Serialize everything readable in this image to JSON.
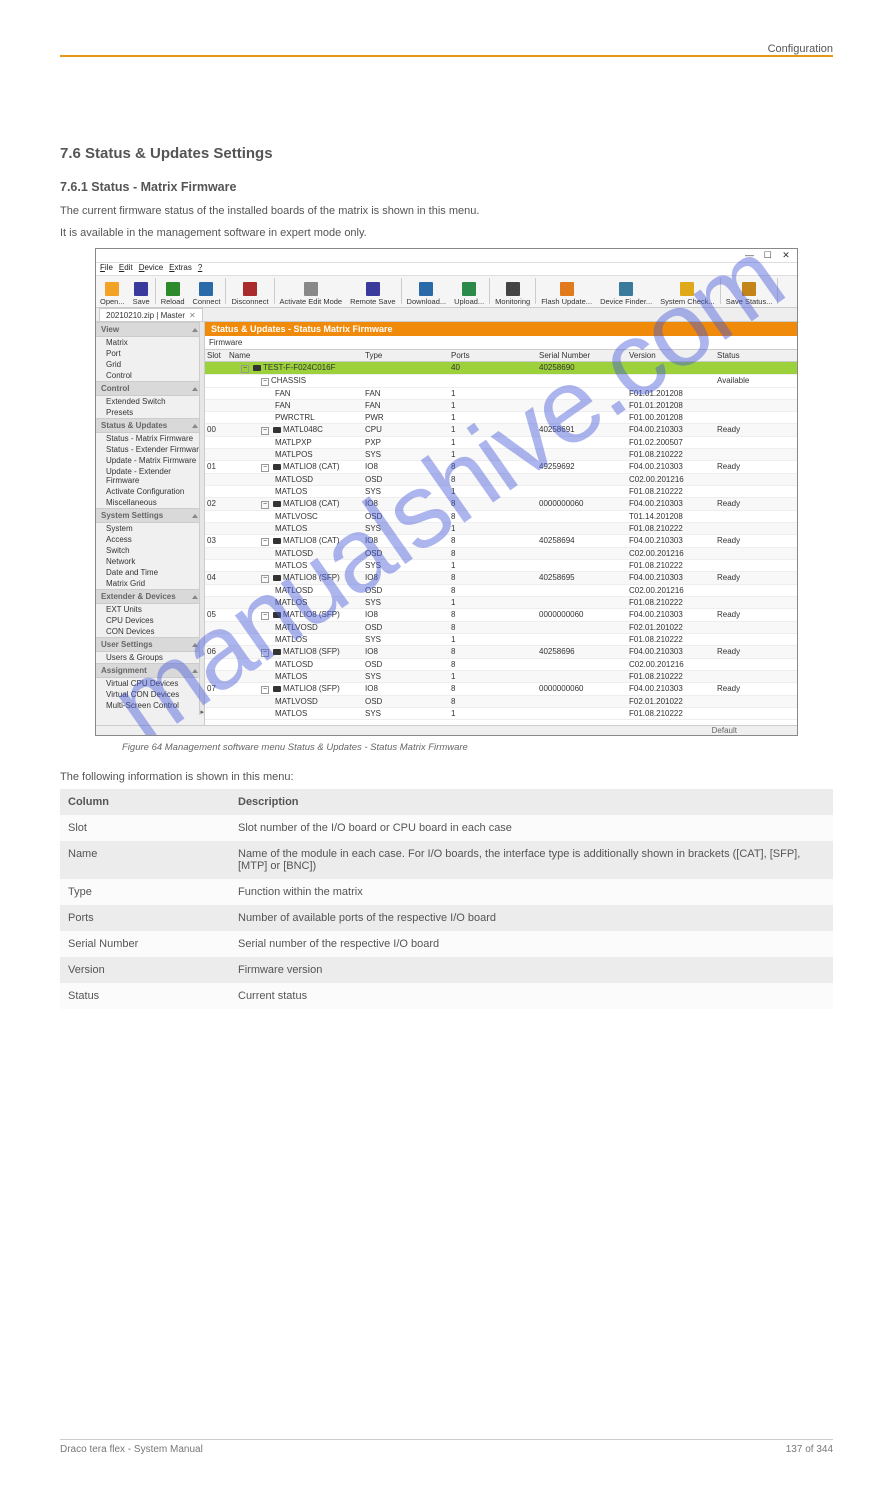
{
  "header_right": "Configuration",
  "section_title": "7.6 Status & Updates Settings",
  "subsection_title": "7.6.1 Status - Matrix Firmware",
  "para1": "The current firmware status of the installed boards of the matrix is shown in this menu.",
  "para2": "It is available in the management software in expert mode only.",
  "fig_caption": "Figure 64  Management software menu Status & Updates - Status Matrix Firmware",
  "col_desc": "The following information is shown in this menu:",
  "columns_table": {
    "headers": [
      "Column",
      "Description"
    ],
    "rows": [
      {
        "c": "Slot",
        "d": "Slot number of the I/O board or CPU board in each case"
      },
      {
        "c": "Name",
        "d": "Name of the module in each case. For I/O boards, the interface type is additionally shown in brackets ([CAT], [SFP], [MTP] or [BNC])"
      },
      {
        "c": "Type",
        "d": "Function within the matrix"
      },
      {
        "c": "Ports",
        "d": "Number of available ports of the respective I/O board"
      },
      {
        "c": "Serial Number",
        "d": "Serial number of the respective I/O board"
      },
      {
        "c": "Version",
        "d": "Firmware version"
      },
      {
        "c": "Status",
        "d": "Current status"
      }
    ]
  },
  "footer": {
    "left": "Draco tera flex - System Manual",
    "right": "137 of 344"
  },
  "watermark": "manualshive.com",
  "app": {
    "win_controls": [
      "—",
      "☐",
      "✕"
    ],
    "menubar": [
      "File",
      "Edit",
      "Device",
      "Extras",
      "?"
    ],
    "toolbar": [
      {
        "label": "Open...",
        "icon": "#f2a225"
      },
      {
        "label": "Save",
        "icon": "#3a3a9c"
      },
      {
        "label": "Reload",
        "icon": "#2c8a2c"
      },
      {
        "label": "Connect",
        "icon": "#2b6aa8"
      },
      {
        "label": "Disconnect",
        "icon": "#aa2b2b"
      },
      {
        "label": "Activate Edit Mode",
        "icon": "#888"
      },
      {
        "label": "Remote Save",
        "icon": "#3a3a9c"
      },
      {
        "label": "Download...",
        "icon": "#2b6aa8"
      },
      {
        "label": "Upload...",
        "icon": "#2b8a4a"
      },
      {
        "label": "Monitoring",
        "icon": "#444"
      },
      {
        "label": "Flash Update...",
        "icon": "#e07a1a"
      },
      {
        "label": "Device Finder...",
        "icon": "#3a7a9c"
      },
      {
        "label": "System Check...",
        "icon": "#e0a91a"
      },
      {
        "label": "Save Status...",
        "icon": "#c3851a"
      }
    ],
    "tab": [
      "20210210.zip | Master"
    ],
    "nav": [
      {
        "hdr": "View",
        "items": [
          "Matrix",
          "Port",
          "Grid",
          "Control"
        ]
      },
      {
        "hdr": "Control",
        "items": [
          "Extended Switch",
          "Presets"
        ]
      },
      {
        "hdr": "Status & Updates",
        "items": [
          "Status - Matrix Firmware",
          "Status - Extender Firmware",
          "Update - Matrix Firmware",
          "Update - Extender Firmware",
          "Activate Configuration",
          "Miscellaneous"
        ]
      },
      {
        "hdr": "System Settings",
        "items": [
          "System",
          "Access",
          "Switch",
          "Network",
          "Date and Time",
          "Matrix Grid"
        ]
      },
      {
        "hdr": "Extender & Devices",
        "items": [
          "EXT Units",
          "CPU Devices",
          "CON Devices"
        ]
      },
      {
        "hdr": "User Settings",
        "items": [
          "Users & Groups"
        ]
      },
      {
        "hdr": "Assignment",
        "items": [
          "Virtual CPU Devices",
          "Virtual CON Devices",
          "Multi-Screen Control"
        ]
      }
    ],
    "main_title": "Status & Updates - Status Matrix Firmware",
    "fw_tab": "Firmware",
    "thead": [
      "Slot",
      "Name",
      "Type",
      "Ports",
      "Serial Number",
      "Version",
      "Status"
    ],
    "rows": [
      {
        "hl": true,
        "slot": "",
        "name": "TEST-F-F024C016F",
        "nameIcon": "dev",
        "type": "",
        "ports": "40",
        "sn": "40258690",
        "ver": "",
        "stat": "",
        "lvl": 1,
        "exp": true
      },
      {
        "slot": "",
        "name": "CHASSIS",
        "type": "",
        "ports": "",
        "sn": "",
        "ver": "",
        "stat": "Available",
        "lvl": 2,
        "exp": true
      },
      {
        "slot": "",
        "name": "FAN",
        "type": "FAN",
        "ports": "1",
        "sn": "",
        "ver": "F01.01.201208",
        "stat": "",
        "lvl": 3
      },
      {
        "slot": "",
        "name": "FAN",
        "type": "FAN",
        "ports": "1",
        "sn": "",
        "ver": "F01.01.201208",
        "stat": "",
        "lvl": 3,
        "alt": true
      },
      {
        "slot": "",
        "name": "PWRCTRL",
        "type": "PWR",
        "ports": "1",
        "sn": "",
        "ver": "F01.00.201208",
        "stat": "",
        "lvl": 3
      },
      {
        "slot": "00",
        "name": "MATL048C",
        "nameIcon": "board",
        "type": "CPU",
        "ports": "1",
        "sn": "40258691",
        "ver": "F04.00.210303",
        "stat": "Ready",
        "lvl": 2,
        "exp": true,
        "alt": true
      },
      {
        "slot": "",
        "name": "MATLPXP",
        "type": "PXP",
        "ports": "1",
        "sn": "",
        "ver": "F01.02.200507",
        "stat": "",
        "lvl": 3
      },
      {
        "slot": "",
        "name": "MATLPOS",
        "type": "SYS",
        "ports": "1",
        "sn": "",
        "ver": "F01.08.210222",
        "stat": "",
        "lvl": 3,
        "alt": true
      },
      {
        "slot": "01",
        "name": "MATLIO8 (CAT)",
        "nameIcon": "board",
        "type": "IO8",
        "ports": "8",
        "sn": "49259692",
        "ver": "F04.00.210303",
        "stat": "Ready",
        "lvl": 2,
        "exp": true
      },
      {
        "slot": "",
        "name": "MATLOSD",
        "type": "OSD",
        "ports": "8",
        "sn": "",
        "ver": "C02.00.201216",
        "stat": "",
        "lvl": 3,
        "alt": true
      },
      {
        "slot": "",
        "name": "MATLOS",
        "type": "SYS",
        "ports": "1",
        "sn": "",
        "ver": "F01.08.210222",
        "stat": "",
        "lvl": 3
      },
      {
        "slot": "02",
        "name": "MATLIO8 (CAT)",
        "nameIcon": "board",
        "type": "IO8",
        "ports": "8",
        "sn": "0000000060",
        "ver": "F04.00.210303",
        "stat": "Ready",
        "lvl": 2,
        "exp": true,
        "alt": true
      },
      {
        "slot": "",
        "name": "MATLVOSC",
        "type": "OSD",
        "ports": "8",
        "sn": "",
        "ver": "T01.14.201208",
        "stat": "",
        "lvl": 3
      },
      {
        "slot": "",
        "name": "MATLOS",
        "type": "SYS",
        "ports": "1",
        "sn": "",
        "ver": "F01.08.210222",
        "stat": "",
        "lvl": 3,
        "alt": true
      },
      {
        "slot": "03",
        "name": "MATLIO8 (CAT)",
        "nameIcon": "board",
        "type": "IO8",
        "ports": "8",
        "sn": "40258694",
        "ver": "F04.00.210303",
        "stat": "Ready",
        "lvl": 2,
        "exp": true
      },
      {
        "slot": "",
        "name": "MATLOSD",
        "type": "OSD",
        "ports": "8",
        "sn": "",
        "ver": "C02.00.201216",
        "stat": "",
        "lvl": 3,
        "alt": true
      },
      {
        "slot": "",
        "name": "MATLOS",
        "type": "SYS",
        "ports": "1",
        "sn": "",
        "ver": "F01.08.210222",
        "stat": "",
        "lvl": 3
      },
      {
        "slot": "04",
        "name": "MATLIO8 (SFP)",
        "nameIcon": "board",
        "type": "IO8",
        "ports": "8",
        "sn": "40258695",
        "ver": "F04.00.210303",
        "stat": "Ready",
        "lvl": 2,
        "exp": true,
        "alt": true
      },
      {
        "slot": "",
        "name": "MATLOSD",
        "type": "OSD",
        "ports": "8",
        "sn": "",
        "ver": "C02.00.201216",
        "stat": "",
        "lvl": 3
      },
      {
        "slot": "",
        "name": "MATLOS",
        "type": "SYS",
        "ports": "1",
        "sn": "",
        "ver": "F01.08.210222",
        "stat": "",
        "lvl": 3,
        "alt": true
      },
      {
        "slot": "05",
        "name": "MATLIO8 (SFP)",
        "nameIcon": "board",
        "type": "IO8",
        "ports": "8",
        "sn": "0000000060",
        "ver": "F04.00.210303",
        "stat": "Ready",
        "lvl": 2,
        "exp": true
      },
      {
        "slot": "",
        "name": "MATLVOSD",
        "type": "OSD",
        "ports": "8",
        "sn": "",
        "ver": "F02.01.201022",
        "stat": "",
        "lvl": 3,
        "alt": true
      },
      {
        "slot": "",
        "name": "MATLOS",
        "type": "SYS",
        "ports": "1",
        "sn": "",
        "ver": "F01.08.210222",
        "stat": "",
        "lvl": 3
      },
      {
        "slot": "06",
        "name": "MATLIO8 (SFP)",
        "nameIcon": "board",
        "type": "IO8",
        "ports": "8",
        "sn": "40258696",
        "ver": "F04.00.210303",
        "stat": "Ready",
        "lvl": 2,
        "exp": true,
        "alt": true
      },
      {
        "slot": "",
        "name": "MATLOSD",
        "type": "OSD",
        "ports": "8",
        "sn": "",
        "ver": "C02.00.201216",
        "stat": "",
        "lvl": 3
      },
      {
        "slot": "",
        "name": "MATLOS",
        "type": "SYS",
        "ports": "1",
        "sn": "",
        "ver": "F01.08.210222",
        "stat": "",
        "lvl": 3,
        "alt": true
      },
      {
        "slot": "07",
        "name": "MATLIO8 (SFP)",
        "nameIcon": "board",
        "type": "IO8",
        "ports": "8",
        "sn": "0000000060",
        "ver": "F04.00.210303",
        "stat": "Ready",
        "lvl": 2,
        "exp": true
      },
      {
        "slot": "",
        "name": "MATLVOSD",
        "type": "OSD",
        "ports": "8",
        "sn": "",
        "ver": "F02.01.201022",
        "stat": "",
        "lvl": 3,
        "alt": true
      },
      {
        "slot": "",
        "name": "MATLOS",
        "type": "SYS",
        "ports": "1",
        "sn": "",
        "ver": "F01.08.210222",
        "stat": "",
        "lvl": 3
      }
    ],
    "status_right": "Default"
  }
}
